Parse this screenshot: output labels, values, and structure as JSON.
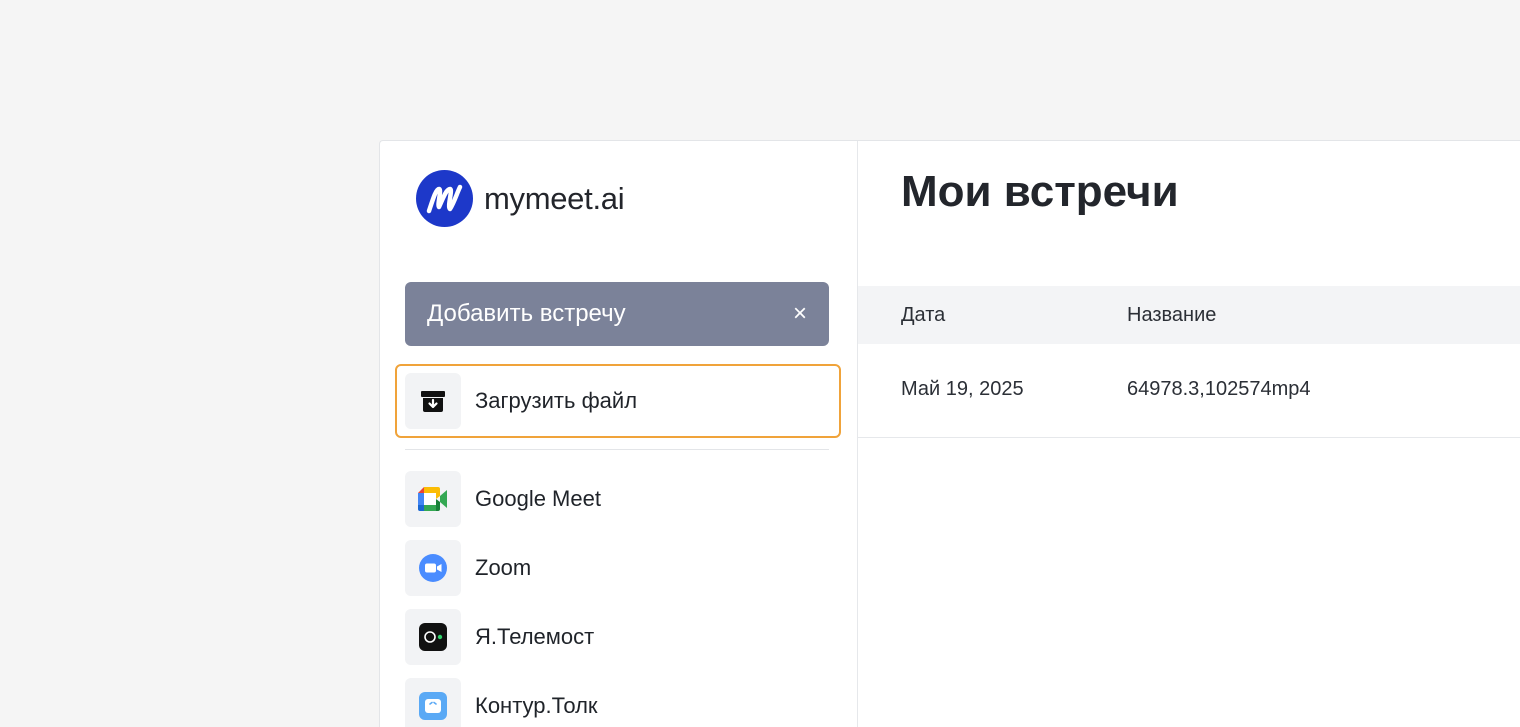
{
  "brand": {
    "name": "mymeet.ai",
    "logo_color": "#1d38c9"
  },
  "sidebar": {
    "add_meeting_label": "Добавить встречу",
    "close_symbol": "×",
    "upload": {
      "label": "Загрузить файл",
      "icon": "archive-download-icon"
    },
    "integrations": [
      {
        "label": "Google Meet",
        "icon": "google-meet-icon"
      },
      {
        "label": "Zoom",
        "icon": "zoom-icon"
      },
      {
        "label": "Я.Телемост",
        "icon": "telemost-icon"
      },
      {
        "label": "Контур.Толк",
        "icon": "kontur-tolk-icon"
      }
    ]
  },
  "main": {
    "title": "Мои встречи",
    "table": {
      "headers": [
        "Дата",
        "Название"
      ],
      "rows": [
        [
          "Май 19, 2025",
          "64978.3,102574mp4"
        ]
      ]
    }
  },
  "colors": {
    "add_button_bg": "#7b8299",
    "highlight_border": "#f0a33a",
    "zoom_blue": "#4a8cff"
  }
}
